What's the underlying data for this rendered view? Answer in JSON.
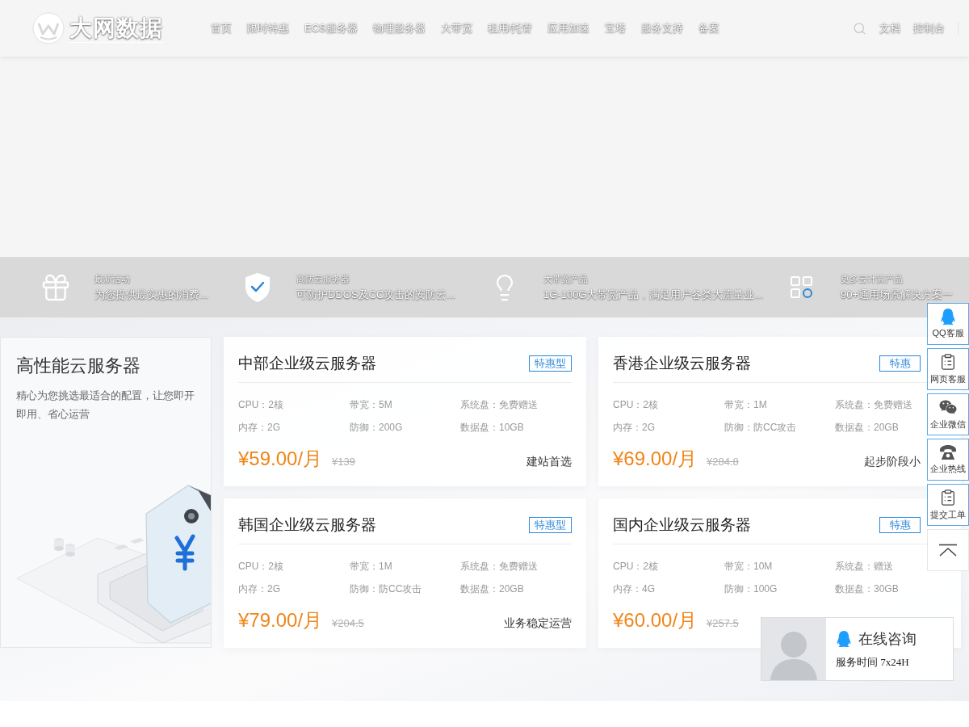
{
  "header": {
    "logo": "大网数据",
    "nav": [
      "首页",
      "限时特惠",
      "ECS服务器",
      "物理服务器",
      "大带宽",
      "租用/托管",
      "应用加速",
      "宝塔",
      "服务支持",
      "备案"
    ],
    "links": [
      "文档",
      "控制台"
    ]
  },
  "features": [
    {
      "title": "最新活动",
      "description": "为您提供最实惠的消费..."
    },
    {
      "title": "高防云服务器",
      "description": "可防护DDOS及CC攻击的安防云..."
    },
    {
      "title": "大带宽产品",
      "description": "1G-100G大带宽产品，满足用户各类大流量业..."
    },
    {
      "title": "更多云计算产品",
      "description": "90+通用场景解决方案一"
    }
  ],
  "intro": {
    "title": "高性能云服务器",
    "description": "精心为您挑选最适合的配置，让您即开即用、省心运营"
  },
  "products": [
    {
      "title": "中部企业级云服务器",
      "tag": "特惠型",
      "specs": [
        "CPU：2核",
        "带宽：5M",
        "系统盘：免费赠送",
        "内存：2G",
        "防御：200G",
        "数据盘：10GB"
      ],
      "price": "¥59.00/月",
      "original_price": "¥139",
      "tagline": "建站首选"
    },
    {
      "title": "香港企业级云服务器",
      "tag": "特惠",
      "specs": [
        "CPU：2核",
        "带宽：1M",
        "系统盘：免费赠送",
        "内存：2G",
        "防御：防CC攻击",
        "数据盘：20GB"
      ],
      "price": "¥69.00/月",
      "original_price": "¥284.8",
      "tagline": "起步阶段小"
    },
    {
      "title": "韩国企业级云服务器",
      "tag": "特惠型",
      "specs": [
        "CPU：2核",
        "带宽：1M",
        "系统盘：免费赠送",
        "内存：2G",
        "防御：防CC攻击",
        "数据盘：20GB"
      ],
      "price": "¥79.00/月",
      "original_price": "¥204.5",
      "tagline": "业务稳定运营"
    },
    {
      "title": "国内企业级云服务器",
      "tag": "特惠",
      "specs": [
        "CPU：2核",
        "带宽：10M",
        "系统盘：赠送",
        "内存：4G",
        "防御：100G",
        "数据盘：30GB"
      ],
      "price": "¥60.00/月",
      "original_price": "¥257.5"
    }
  ],
  "side_toolbar": [
    "QQ客服",
    "网页客服",
    "企业微信",
    "企业热线",
    "提交工单"
  ],
  "chat_widget": {
    "title": "在线咨询",
    "hours": "服务时间 7x24H"
  }
}
